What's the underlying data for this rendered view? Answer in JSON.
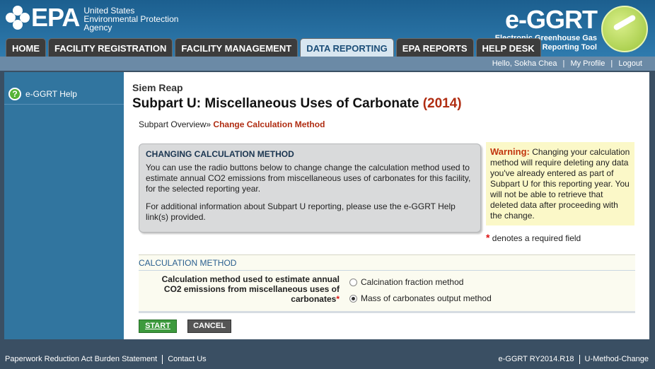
{
  "header": {
    "epa_mark": "EPA",
    "agency_lines": [
      "United States",
      "Environmental Protection",
      "Agency"
    ],
    "ggrt_title": "e-GGRT",
    "ggrt_sub_lines": [
      "Electronic Greenhouse Gas",
      "Reporting Tool"
    ]
  },
  "tabs": [
    {
      "label": "HOME",
      "active": false
    },
    {
      "label": "FACILITY REGISTRATION",
      "active": false
    },
    {
      "label": "FACILITY MANAGEMENT",
      "active": false
    },
    {
      "label": "DATA REPORTING",
      "active": true
    },
    {
      "label": "EPA REPORTS",
      "active": false
    },
    {
      "label": "HELP DESK",
      "active": false
    }
  ],
  "utilbar": {
    "greeting": "Hello, Sokha Chea",
    "profile": "My Profile",
    "logout": "Logout"
  },
  "sidebar": {
    "help_label": "e-GGRT Help",
    "help_icon": "question-mark-icon"
  },
  "content": {
    "facility": "Siem Reap",
    "title": "Subpart U: Miscellaneous Uses of Carbonate",
    "year": "(2014)",
    "breadcrumb_parent": "Subpart Overview",
    "breadcrumb_sep": "»",
    "breadcrumb_current": "Change Calculation Method"
  },
  "info": {
    "heading": "CHANGING CALCULATION METHOD",
    "para1": "You can use the radio buttons below to change change the calculation method used to estimate annual CO2 emissions from miscellaneous uses of carbonates for this facility, for the selected reporting year.",
    "para2": "For additional information about Subpart U reporting, please use the e-GGRT Help link(s) provided."
  },
  "warning": {
    "label": "Warning:",
    "text": "Changing your calculation method will require deleting any data you've already entered as part of Subpart U for this reporting year. You will not be able to retrieve that deleted data after proceeding with the change."
  },
  "required_note": {
    "star": "*",
    "text": "denotes a required field"
  },
  "calc": {
    "section_title": "CALCULATION METHOD",
    "field_label": "Calculation method used to estimate annual CO2 emissions from miscellaneous uses of carbonates",
    "star": "*",
    "options": [
      {
        "label": "Calcination fraction method",
        "selected": false
      },
      {
        "label": "Mass of carbonates output method",
        "selected": true
      }
    ]
  },
  "buttons": {
    "start": "START",
    "cancel": "CANCEL"
  },
  "footer": {
    "paperwork": "Paperwork Reduction Act Burden Statement",
    "contact": "Contact Us",
    "version": "e-GGRT RY2014.R18",
    "page_id": "U-Method-Change"
  }
}
